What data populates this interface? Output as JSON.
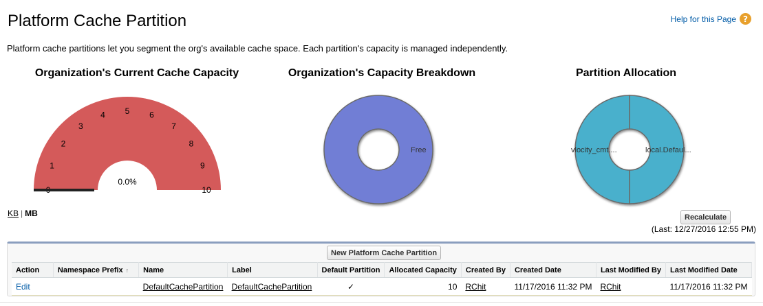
{
  "page": {
    "title": "Platform Cache Partition",
    "help_label": "Help for this Page",
    "help_icon_glyph": "?",
    "description": "Platform cache partitions let you segment the org's available cache space. Each partition's capacity is managed independently."
  },
  "colors": {
    "gauge_fill": "#d45a5a",
    "capacity_breakdown": "#717ed5",
    "partition_allocation": "#48b0cc",
    "link_blue": "#015ba7",
    "help_icon": "#e8a02c",
    "panel_border_top": "#8a9ebe"
  },
  "units": {
    "kb": "KB",
    "separator": "|",
    "mb": "MB"
  },
  "chart_data": [
    {
      "type": "gauge",
      "title": "Organization's Current Cache Capacity",
      "tick_labels": [
        "0",
        "1",
        "2",
        "3",
        "4",
        "5",
        "6",
        "7",
        "8",
        "9",
        "10"
      ],
      "min": 0,
      "max": 10,
      "value": 0,
      "value_label": "0.0%"
    },
    {
      "type": "pie",
      "title": "Organization's Capacity Breakdown",
      "categories": [
        "Free"
      ],
      "values": [
        100
      ]
    },
    {
      "type": "pie",
      "title": "Partition Allocation",
      "categories": [
        "vlocity_cmt....",
        "local.Defaul..."
      ],
      "values": [
        50,
        50
      ]
    }
  ],
  "actions": {
    "recalculate": "Recalculate",
    "last_calculated": "(Last: 12/27/2016 12:55 PM)",
    "new_partition": "New Platform Cache Partition"
  },
  "table": {
    "headers": {
      "action": "Action",
      "namespace": "Namespace Prefix",
      "namespace_sort": "↑",
      "name": "Name",
      "label": "Label",
      "default": "Default Partition",
      "allocated": "Allocated Capacity",
      "created_by": "Created By",
      "created_date": "Created Date",
      "modified_by": "Last Modified By",
      "modified_date": "Last Modified Date"
    },
    "rows": [
      {
        "action": "Edit",
        "namespace": "",
        "name": "DefaultCachePartition",
        "label": "DefaultCachePartition",
        "default_mark": "✓",
        "allocated": "10",
        "created_by": "RChit",
        "created_date": "11/17/2016 11:32 PM",
        "modified_by": "RChit",
        "modified_date": "11/17/2016 11:32 PM"
      }
    ]
  }
}
